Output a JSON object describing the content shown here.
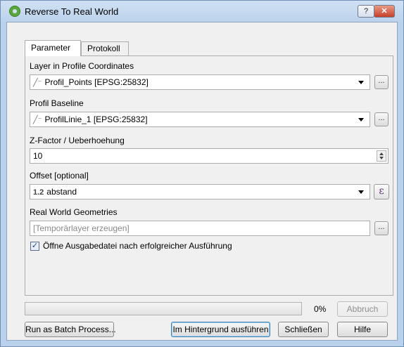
{
  "window": {
    "title": "Reverse To Real World",
    "help_label": "?",
    "close_label": "✕"
  },
  "tabs": [
    {
      "label": "Parameter",
      "active": true
    },
    {
      "label": "Protokoll",
      "active": false
    }
  ],
  "params": {
    "layer_profile": {
      "label": "Layer in Profile Coordinates",
      "value": "Profil_Points [EPSG:25832]"
    },
    "profile_baseline": {
      "label": "Profil Baseline",
      "value": "ProfilLinie_1 [EPSG:25832]"
    },
    "zfactor": {
      "label": "Z-Factor / Ueberhoehung",
      "value": "10"
    },
    "offset": {
      "label": "Offset [optional]",
      "type_marker": "1.2",
      "value": "abstand",
      "expr_label": "ε"
    },
    "real_world": {
      "label": "Real World Geometries",
      "placeholder": "[Temporärlayer erzeugen]"
    },
    "open_output": {
      "label": "Öffne Ausgabedatei nach erfolgreicher Ausführung",
      "checked": true,
      "mark": "✓"
    }
  },
  "browse_label": "...",
  "progress": {
    "value": 0,
    "text": "0%"
  },
  "buttons": {
    "cancel": "Abbruch",
    "batch": "Run as Batch Process...",
    "run_background": "Im Hintergrund ausführen",
    "close": "Schließen",
    "help": "Hilfe"
  },
  "colors": {
    "progress_fill": "#06b025",
    "title_bar": "#bcd3ec"
  }
}
